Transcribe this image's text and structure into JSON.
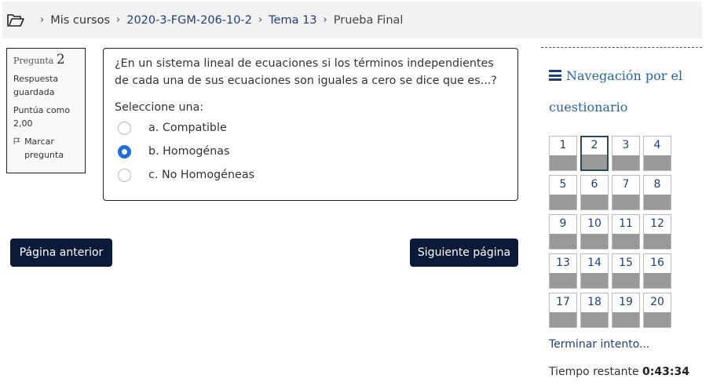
{
  "breadcrumb": {
    "icon": "folder-open-icon",
    "items": [
      {
        "label": "Mis cursos"
      },
      {
        "label": "2020-3-FGM-206-10-2"
      },
      {
        "label": "Tema 13"
      },
      {
        "label": "Prueba Final"
      }
    ]
  },
  "question_info": {
    "label": "Pregunta",
    "number": "2",
    "status": "Respuesta guardada",
    "score": "Puntúa como 2,00",
    "flag_label": "Marcar pregunta",
    "flag_icon": "flag-icon"
  },
  "question": {
    "text": "¿En un sistema lineal de ecuaciones si los términos independientes de cada una de sus ecuaciones son iguales a cero se dice que es...?",
    "prompt": "Seleccione una:",
    "options": [
      {
        "label": "a. Compatible",
        "selected": false
      },
      {
        "label": "b. Homogénas",
        "selected": true
      },
      {
        "label": "c. No Homogéneas",
        "selected": false
      }
    ]
  },
  "buttons": {
    "prev": "Página anterior",
    "next": "Siguiente página"
  },
  "navigation": {
    "title": "Navegación por el cuestionario",
    "icon": "hamburger-icon",
    "questions": [
      "1",
      "2",
      "3",
      "4",
      "5",
      "6",
      "7",
      "8",
      "9",
      "10",
      "11",
      "12",
      "13",
      "14",
      "15",
      "16",
      "17",
      "18",
      "19",
      "20"
    ],
    "current": "2",
    "finish_link": "Terminar intento...",
    "time_label": "Tiempo restante",
    "time_value": "0:43:34"
  },
  "colors": {
    "link": "#1f3f7a",
    "button_bg": "#0c1a3a",
    "radio_selected": "#1f6fd6",
    "answered_fill": "#999999"
  }
}
